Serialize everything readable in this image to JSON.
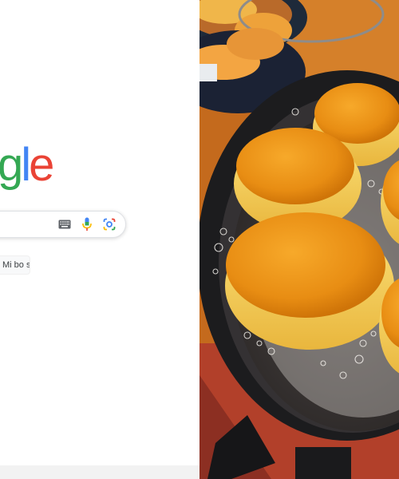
{
  "logo": {
    "letters": [
      "g",
      "l",
      "e"
    ],
    "colors": [
      "#34a853",
      "#4285f4",
      "#ea4335"
    ]
  },
  "search": {
    "value": "",
    "placeholder": "",
    "icons": [
      "keyboard-icon",
      "microphone-icon",
      "lens-camera-icon"
    ]
  },
  "buttons": {
    "lucky_label": "Mi bo sreča"
  },
  "photo": {
    "subject": "doughnuts-frying-in-pan"
  },
  "colors": {
    "search_border": "#dfe1e5",
    "button_bg": "#f8f9fa",
    "footer_bg": "#f2f2f2"
  }
}
